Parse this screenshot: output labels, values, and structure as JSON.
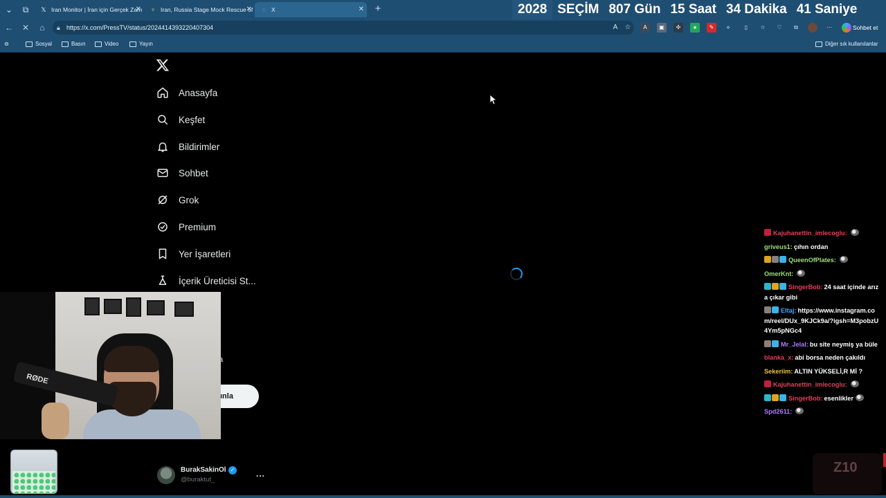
{
  "tabs": [
    {
      "title": "Iran Monitor | İran için Gerçek Zam",
      "favicon": "x-favicon"
    },
    {
      "title": "Iran, Russia Stage Mock Rescue of",
      "favicon": "presstv-favicon"
    },
    {
      "title": "X",
      "favicon": "loading-spinner"
    }
  ],
  "banner": {
    "year": "2028",
    "label": "SEÇİM",
    "days": "807 Gün",
    "hours": "15 Saat",
    "minutes": "34 Dakika",
    "seconds": "41 Saniye"
  },
  "address": {
    "url": "https://x.com/PressTV/status/2024414393220407304"
  },
  "copilot": {
    "label": "Sohbet et"
  },
  "bookmarks": [
    {
      "label": "Sosyal"
    },
    {
      "label": "Basın"
    },
    {
      "label": "Video"
    },
    {
      "label": "Yayın"
    }
  ],
  "other_bookmarks": "Diğer sık kullanılanlar",
  "nav": [
    {
      "label": "Anasayfa",
      "icon": "home-icon"
    },
    {
      "label": "Keşfet",
      "icon": "search-icon"
    },
    {
      "label": "Bildirimler",
      "icon": "bell-icon"
    },
    {
      "label": "Sohbet",
      "icon": "mail-icon"
    },
    {
      "label": "Grok",
      "icon": "grok-icon"
    },
    {
      "label": "Premium",
      "icon": "premium-icon"
    },
    {
      "label": "Yer İşaretleri",
      "icon": "bookmark-icon"
    },
    {
      "label": "İçerik Üreticisi St...",
      "icon": "creator-studio-icon"
    }
  ],
  "partial_text": "a",
  "post_button_partial": "ınla",
  "webcam": {
    "mic_brand": "RØDE"
  },
  "profile": {
    "name": "BurakSakinOl",
    "handle": "@buraktut_",
    "more": "..."
  },
  "chat": [
    {
      "user": "Kajuhanettin_imlecoglu:",
      "user_color": "#e0405a",
      "text": "",
      "emote": true,
      "badges": [
        "#c0203a"
      ]
    },
    {
      "user": "griveus1:",
      "user_color": "#9ee07a",
      "text": "çıhın ordan",
      "emote": false,
      "badges": []
    },
    {
      "user": "QueenOfPlates:",
      "user_color": "#9ee07a",
      "text": "",
      "emote": true,
      "badges": [
        "#d9a521",
        "#8a7f7a",
        "#3bb2e8"
      ]
    },
    {
      "user": "OmerKnt:",
      "user_color": "#9ee07a",
      "text": "",
      "emote": true,
      "badges": []
    },
    {
      "user": "SingerBob:",
      "user_color": "#e0405a",
      "text": "24 saat içinde arıza çıkar gibi",
      "emote": false,
      "badges": [
        "#2cb6c9",
        "#e6a317",
        "#3bb2e8"
      ]
    },
    {
      "user": "Eltaj:",
      "user_color": "#4aa3ff",
      "text": "https://www.instagram.com/reel/DUx_9KJCk9a/?igsh=M3pobzU4Ym5pNGc4",
      "emote": false,
      "badges": [
        "#8a7f7a",
        "#3bb2e8"
      ]
    },
    {
      "user": "Mr_Jelal:",
      "user_color": "#b07aff",
      "text": "bu site neymiş ya büle",
      "emote": false,
      "badges": [
        "#8a7f7a",
        "#3bb2e8"
      ]
    },
    {
      "user": "blanka_x:",
      "user_color": "#e0405a",
      "text": "abi borsa neden çakıldı",
      "emote": false,
      "badges": []
    },
    {
      "user": "Sekeriim:",
      "user_color": "#f0c040",
      "text": "ALTIN YÜKSELİ,R Mİ ?",
      "emote": false,
      "badges": []
    },
    {
      "user": "Kajuhanettin_imlecoglu:",
      "user_color": "#e0405a",
      "text": "",
      "emote": true,
      "badges": [
        "#c0203a"
      ]
    },
    {
      "user": "SingerBob:",
      "user_color": "#e0405a",
      "text": "esenlikler",
      "emote": true,
      "badges": [
        "#2cb6c9",
        "#e6a317",
        "#3bb2e8"
      ]
    },
    {
      "user": "Spd2611:",
      "user_color": "#b07aff",
      "text": "",
      "emote": true,
      "badges": []
    }
  ],
  "colors": {
    "browser_chrome": "#1f4e73",
    "x_background": "#000000",
    "x_text": "#e7e9ea",
    "x_accent": "#1d9bf0"
  }
}
